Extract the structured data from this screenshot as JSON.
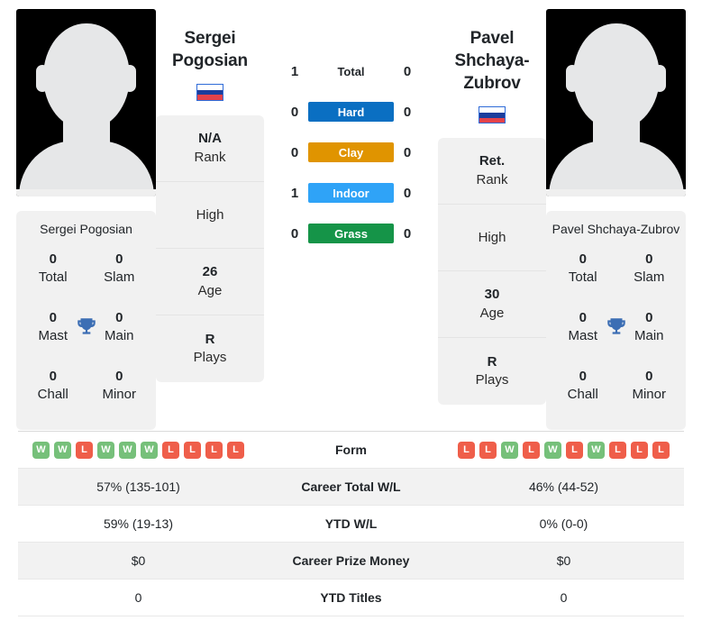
{
  "players": {
    "left": {
      "name": "Sergei Pogosian",
      "name_line1": "Sergei",
      "name_line2": "Pogosian",
      "flag": "russia-flag",
      "rank": "N/A",
      "rank_label": "Rank",
      "high_label": "High",
      "high_value": "",
      "age": "26",
      "age_label": "Age",
      "plays": "R",
      "plays_label": "Plays",
      "titles": {
        "total": "0",
        "total_label": "Total",
        "slam": "0",
        "slam_label": "Slam",
        "mast": "0",
        "mast_label": "Mast",
        "main": "0",
        "main_label": "Main",
        "chall": "0",
        "chall_label": "Chall",
        "minor": "0",
        "minor_label": "Minor"
      },
      "form": [
        "W",
        "W",
        "L",
        "W",
        "W",
        "W",
        "L",
        "L",
        "L",
        "L"
      ],
      "career_wl": "57% (135-101)",
      "ytd_wl": "59% (19-13)",
      "career_prize": "$0",
      "ytd_titles": "0"
    },
    "right": {
      "name": "Pavel Shchaya-Zubrov",
      "name_line1": "Pavel Shchaya-",
      "name_line2": "Zubrov",
      "flag": "russia-flag",
      "rank": "Ret.",
      "rank_label": "Rank",
      "high_label": "High",
      "high_value": "",
      "age": "30",
      "age_label": "Age",
      "plays": "R",
      "plays_label": "Plays",
      "titles": {
        "total": "0",
        "total_label": "Total",
        "slam": "0",
        "slam_label": "Slam",
        "mast": "0",
        "mast_label": "Mast",
        "main": "0",
        "main_label": "Main",
        "chall": "0",
        "chall_label": "Chall",
        "minor": "0",
        "minor_label": "Minor"
      },
      "form": [
        "L",
        "L",
        "W",
        "L",
        "W",
        "L",
        "W",
        "L",
        "L",
        "L"
      ],
      "career_wl": "46% (44-52)",
      "ytd_wl": "0% (0-0)",
      "career_prize": "$0",
      "ytd_titles": "0"
    }
  },
  "h2h": {
    "rows": [
      {
        "label": "Total",
        "left": "1",
        "right": "0",
        "color": "",
        "badge": false
      },
      {
        "label": "Hard",
        "left": "0",
        "right": "0",
        "color": "#0a6fc2",
        "badge": true
      },
      {
        "label": "Clay",
        "left": "0",
        "right": "0",
        "color": "#e09400",
        "badge": true
      },
      {
        "label": "Indoor",
        "left": "1",
        "right": "0",
        "color": "#2fa3f7",
        "badge": true
      },
      {
        "label": "Grass",
        "left": "0",
        "right": "0",
        "color": "#159448",
        "badge": true
      }
    ]
  },
  "table": {
    "rows": [
      {
        "label": "Form",
        "type": "form"
      },
      {
        "label": "Career Total W/L",
        "type": "text",
        "left": "57% (135-101)",
        "right": "46% (44-52)"
      },
      {
        "label": "YTD W/L",
        "type": "text",
        "left": "59% (19-13)",
        "right": "0% (0-0)"
      },
      {
        "label": "Career Prize Money",
        "type": "text",
        "left": "$0",
        "right": "$0"
      },
      {
        "label": "YTD Titles",
        "type": "text",
        "left": "0",
        "right": "0"
      }
    ]
  },
  "colors": {
    "win": "#76c07a",
    "loss": "#ef5e4a",
    "hard": "#0a6fc2",
    "clay": "#e09400",
    "indoor": "#2fa3f7",
    "grass": "#159448",
    "trophy": "#3c6eb4"
  }
}
